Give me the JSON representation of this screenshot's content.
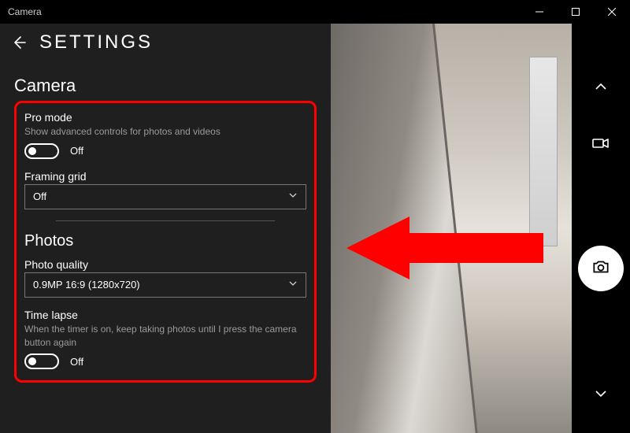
{
  "titlebar": {
    "appname": "Camera"
  },
  "settings": {
    "title": "SETTINGS",
    "camera_section": "Camera",
    "pro_mode": {
      "label": "Pro mode",
      "desc": "Show advanced controls for photos and videos",
      "state": "Off"
    },
    "framing_grid": {
      "label": "Framing grid",
      "value": "Off"
    },
    "photos_section": "Photos",
    "photo_quality": {
      "label": "Photo quality",
      "value": "0.9MP 16:9 (1280x720)"
    },
    "time_lapse": {
      "label": "Time lapse",
      "desc": "When the timer is on, keep taking photos until I press the camera button again",
      "state": "Off"
    }
  }
}
